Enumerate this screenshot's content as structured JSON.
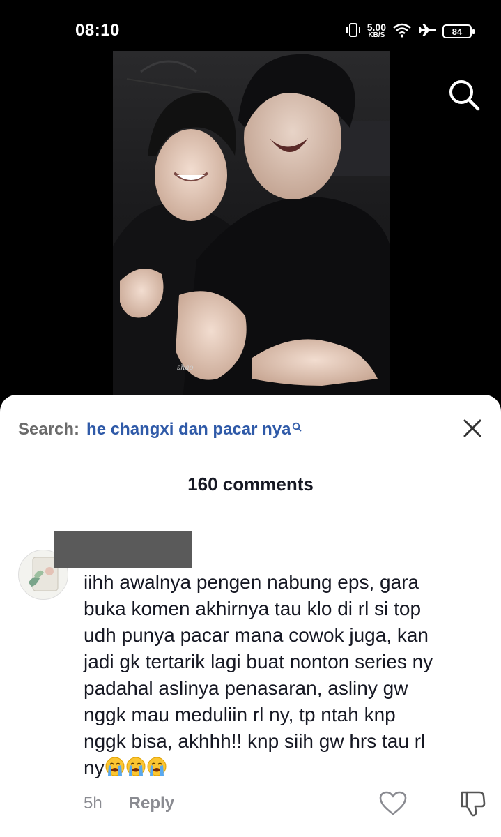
{
  "status_bar": {
    "time": "08:10",
    "net_speed_value": "5.00",
    "net_speed_unit": "KB/S",
    "battery": "84",
    "icons": [
      "vibrate-icon",
      "wifi-icon",
      "airplane-icon",
      "battery-icon"
    ]
  },
  "video": {
    "watermark": "shao",
    "search_icon": "search-icon"
  },
  "comments_sheet": {
    "search_label": "Search:",
    "search_query": "he changxi dan pacar nya",
    "close_icon": "close-icon",
    "comment_count": "160 comments"
  },
  "comment": {
    "text": "iihh awalnya pengen nabung eps, gara\nbuka komen akhirnya tau klo di rl si top\nudh punya pacar mana cowok juga, kan\njadi gk tertarik lagi buat nonton series ny\npadahal aslinya penasaran, asliny gw\nnggk mau meduliin rl ny, tp ntah knp\nnggk bisa, akhhh!! knp siih gw hrs tau rl\nny",
    "emojis": [
      "loudly-crying-face",
      "loudly-crying-face",
      "loudly-crying-face"
    ],
    "time_ago": "5h",
    "reply_label": "Reply",
    "like_icon": "heart-outline-icon",
    "dislike_icon": "thumbs-down-icon"
  },
  "colors": {
    "background": "#000000",
    "sheet": "#ffffff",
    "query_link": "#2f5aa8",
    "muted": "#8a8b91",
    "text": "#161823"
  }
}
